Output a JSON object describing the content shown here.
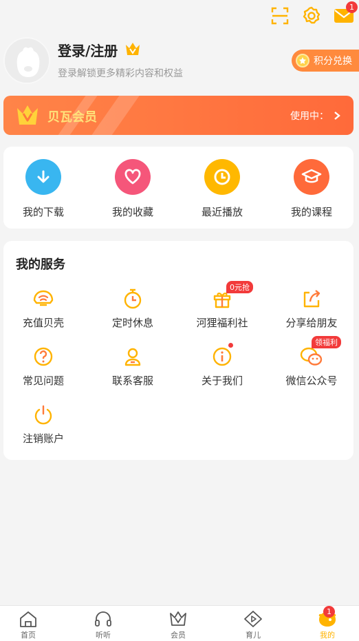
{
  "top": {
    "scan_icon": "scan-icon",
    "settings_icon": "gear-icon",
    "mail_icon": "mail-icon",
    "mail_badge": "1"
  },
  "profile": {
    "title": "登录/注册",
    "subtitle": "登录解锁更多精彩内容和权益",
    "points_label": "积分兑换"
  },
  "vip": {
    "title": "贝瓦会员",
    "status": "使用中："
  },
  "quick": [
    {
      "label": "我的下载",
      "icon": "download-icon",
      "color": "#39b6f0"
    },
    {
      "label": "我的收藏",
      "icon": "heart-icon",
      "color": "#f5567a"
    },
    {
      "label": "最近播放",
      "icon": "clock-icon",
      "color": "#ffb800"
    },
    {
      "label": "我的课程",
      "icon": "graduation-cap-icon",
      "color": "#ff6a3a"
    }
  ],
  "services": {
    "title": "我的服务",
    "items": [
      {
        "label": "充值贝壳",
        "icon": "shell-icon"
      },
      {
        "label": "定时休息",
        "icon": "timer-icon"
      },
      {
        "label": "河狸福利社",
        "icon": "gift-icon",
        "tag": "0元抢"
      },
      {
        "label": "分享给朋友",
        "icon": "share-icon"
      },
      {
        "label": "常见问题",
        "icon": "question-icon"
      },
      {
        "label": "联系客服",
        "icon": "customer-service-icon"
      },
      {
        "label": "关于我们",
        "icon": "info-icon"
      },
      {
        "label": "微信公众号",
        "icon": "wechat-icon",
        "tag": "领福利"
      },
      {
        "label": "注销账户",
        "icon": "power-icon"
      }
    ]
  },
  "tabs": [
    {
      "label": "首页",
      "icon": "home-icon"
    },
    {
      "label": "听听",
      "icon": "headphones-icon"
    },
    {
      "label": "会员",
      "icon": "crown-icon"
    },
    {
      "label": "育儿",
      "icon": "play-diamond-icon"
    },
    {
      "label": "我的",
      "icon": "mascot-icon",
      "badge": "1",
      "active": true
    }
  ],
  "colors": {
    "accent": "#ffb300",
    "orange": "#ff6a3a",
    "badge": "#f23a3a"
  }
}
